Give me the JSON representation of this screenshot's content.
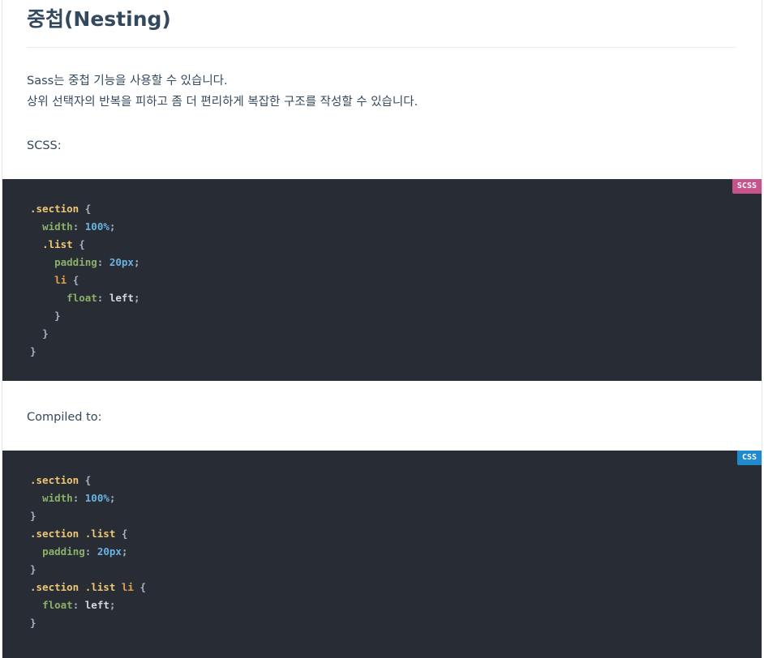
{
  "page": {
    "title": "중첩(Nesting)",
    "intro_line1": "Sass는 중첩 기능을 사용할 수 있습니다.",
    "intro_line2": "상위 선택자의 반복을 피하고 좀 더 편리하게 복잡한 구조를 작성할 수 있습니다.",
    "scss_label": "SCSS:",
    "compiled_label": "Compiled to:"
  },
  "scss_block": {
    "badge": "SCSS",
    "badge_color": "#c6538c",
    "lines": [
      [
        {
          "t": "sel",
          "v": ".section"
        },
        {
          "t": "punc",
          "v": " {"
        }
      ],
      [
        {
          "t": "sp",
          "v": "  "
        },
        {
          "t": "prop",
          "v": "width"
        },
        {
          "t": "punc",
          "v": ": "
        },
        {
          "t": "num",
          "v": "100%"
        },
        {
          "t": "punc",
          "v": ";"
        }
      ],
      [
        {
          "t": "sp",
          "v": "  "
        },
        {
          "t": "sel",
          "v": ".list"
        },
        {
          "t": "punc",
          "v": " {"
        }
      ],
      [
        {
          "t": "sp",
          "v": "    "
        },
        {
          "t": "prop",
          "v": "padding"
        },
        {
          "t": "punc",
          "v": ": "
        },
        {
          "t": "num",
          "v": "20px"
        },
        {
          "t": "punc",
          "v": ";"
        }
      ],
      [
        {
          "t": "sp",
          "v": "    "
        },
        {
          "t": "tag",
          "v": "li"
        },
        {
          "t": "punc",
          "v": " {"
        }
      ],
      [
        {
          "t": "sp",
          "v": "      "
        },
        {
          "t": "prop",
          "v": "float"
        },
        {
          "t": "punc",
          "v": ": "
        },
        {
          "t": "val",
          "v": "left"
        },
        {
          "t": "punc",
          "v": ";"
        }
      ],
      [
        {
          "t": "sp",
          "v": "    "
        },
        {
          "t": "punc",
          "v": "}"
        }
      ],
      [
        {
          "t": "sp",
          "v": "  "
        },
        {
          "t": "punc",
          "v": "}"
        }
      ],
      [
        {
          "t": "punc",
          "v": "}"
        }
      ]
    ]
  },
  "css_block": {
    "badge": "CSS",
    "badge_color": "#1f8acd",
    "lines": [
      [
        {
          "t": "sel",
          "v": ".section"
        },
        {
          "t": "punc",
          "v": " {"
        }
      ],
      [
        {
          "t": "sp",
          "v": "  "
        },
        {
          "t": "prop",
          "v": "width"
        },
        {
          "t": "punc",
          "v": ": "
        },
        {
          "t": "num",
          "v": "100%"
        },
        {
          "t": "punc",
          "v": ";"
        }
      ],
      [
        {
          "t": "punc",
          "v": "}"
        }
      ],
      [
        {
          "t": "sel",
          "v": ".section .list"
        },
        {
          "t": "punc",
          "v": " {"
        }
      ],
      [
        {
          "t": "sp",
          "v": "  "
        },
        {
          "t": "prop",
          "v": "padding"
        },
        {
          "t": "punc",
          "v": ": "
        },
        {
          "t": "num",
          "v": "20px"
        },
        {
          "t": "punc",
          "v": ";"
        }
      ],
      [
        {
          "t": "punc",
          "v": "}"
        }
      ],
      [
        {
          "t": "sel",
          "v": ".section .list"
        },
        {
          "t": "punc",
          "v": " "
        },
        {
          "t": "tag",
          "v": "li"
        },
        {
          "t": "punc",
          "v": " {"
        }
      ],
      [
        {
          "t": "sp",
          "v": "  "
        },
        {
          "t": "prop",
          "v": "float"
        },
        {
          "t": "punc",
          "v": ": "
        },
        {
          "t": "val",
          "v": "left"
        },
        {
          "t": "punc",
          "v": ";"
        }
      ],
      [
        {
          "t": "punc",
          "v": "}"
        }
      ]
    ]
  }
}
